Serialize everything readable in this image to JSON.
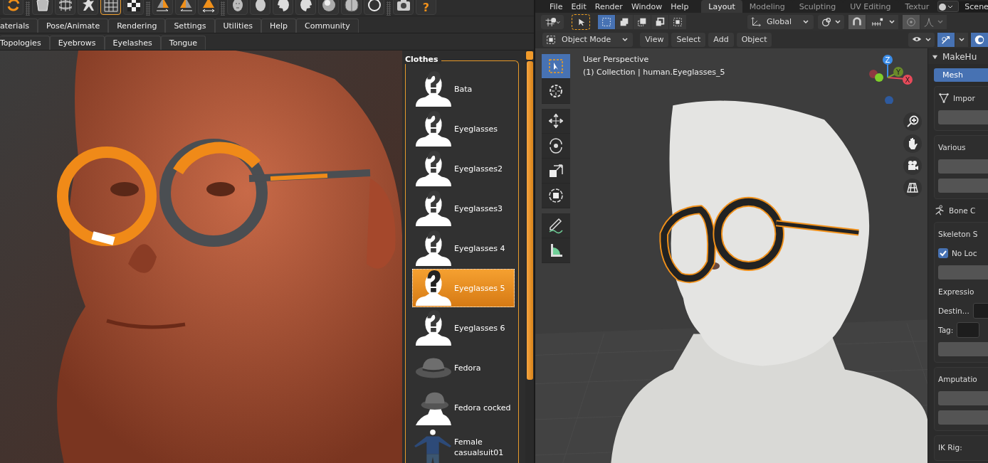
{
  "makehuman": {
    "toolbar": [
      {
        "kind": "rotate",
        "selected": false
      },
      {
        "kind": "separator"
      },
      {
        "kind": "cloth",
        "selected": false
      },
      {
        "kind": "wire",
        "selected": false
      },
      {
        "kind": "figure",
        "selected": false
      },
      {
        "kind": "grid",
        "selected": true
      },
      {
        "kind": "checker",
        "selected": false
      },
      {
        "kind": "separator"
      },
      {
        "kind": "arrow-right",
        "selected": false
      },
      {
        "kind": "arrow-left",
        "selected": false
      },
      {
        "kind": "arrow-both",
        "selected": false
      },
      {
        "kind": "separator"
      },
      {
        "kind": "face",
        "selected": false
      },
      {
        "kind": "egg",
        "selected": false
      },
      {
        "kind": "head-left",
        "selected": false
      },
      {
        "kind": "head-right",
        "selected": false
      },
      {
        "kind": "sphere",
        "selected": false
      },
      {
        "kind": "brain",
        "selected": false
      },
      {
        "kind": "ring",
        "selected": false
      },
      {
        "kind": "separator"
      },
      {
        "kind": "camera",
        "selected": false
      },
      {
        "kind": "help",
        "label": "?",
        "selected": false
      }
    ],
    "tabs": [
      "aterials",
      "Pose/Animate",
      "Rendering",
      "Settings",
      "Utilities",
      "Help",
      "Community"
    ],
    "subtabs": [
      "Topologies",
      "Eyebrows",
      "Eyelashes",
      "Tongue"
    ],
    "clothes": {
      "title": "Clothes",
      "items": [
        {
          "name": "Bata",
          "kind": "silhouette",
          "selected": false
        },
        {
          "name": "Eyeglasses",
          "kind": "silhouette",
          "selected": false
        },
        {
          "name": "Eyeglasses2",
          "kind": "silhouette",
          "selected": false
        },
        {
          "name": "Eyeglasses3",
          "kind": "silhouette",
          "selected": false
        },
        {
          "name": "Eyeglasses 4",
          "kind": "silhouette",
          "selected": false
        },
        {
          "name": "Eyeglasses 5",
          "kind": "silhouette",
          "selected": true
        },
        {
          "name": "Eyeglasses 6",
          "kind": "silhouette",
          "selected": false
        },
        {
          "name": "Fedora",
          "kind": "hat",
          "selected": false
        },
        {
          "name": "Fedora cocked",
          "kind": "hat-figure",
          "selected": false
        },
        {
          "name": "Female casualsuit01",
          "kind": "suit",
          "selected": false
        }
      ]
    }
  },
  "blender": {
    "menu": [
      "File",
      "Edit",
      "Render",
      "Window",
      "Help"
    ],
    "workspaces": [
      {
        "label": "Layout",
        "selected": true
      },
      {
        "label": "Modeling",
        "selected": false
      },
      {
        "label": "Sculpting",
        "selected": false
      },
      {
        "label": "UV Editing",
        "selected": false
      },
      {
        "label": "Textur",
        "selected": false
      }
    ],
    "scene": "Scene",
    "orientation": "Global",
    "mode": "Object Mode",
    "view_menus": [
      "View",
      "Select",
      "Add",
      "Object"
    ],
    "overlay_lines": [
      "User Perspective",
      "(1) Collection | human.Eyeglasses_5"
    ],
    "tools": [
      {
        "kind": "select",
        "selected": true
      },
      {
        "kind": "cursor",
        "selected": false
      },
      {
        "kind": "move",
        "selected": false
      },
      {
        "kind": "rotate",
        "selected": false
      },
      {
        "kind": "scale",
        "selected": false
      },
      {
        "kind": "transform",
        "selected": false
      },
      {
        "kind": "annotate",
        "selected": false
      },
      {
        "kind": "measure",
        "selected": false
      }
    ],
    "axes": [
      "X",
      "Y",
      "Z"
    ],
    "sidebar": {
      "title": "MakeHu",
      "tab": {
        "label": "Mesh",
        "selected": true
      },
      "sections": [
        {
          "kind": "panel",
          "title": "Impor",
          "rows": [
            {
              "kind": "button"
            }
          ]
        },
        {
          "kind": "panel",
          "title": "Various",
          "rows": [
            {
              "kind": "button"
            },
            {
              "kind": "button"
            }
          ]
        },
        {
          "kind": "heading",
          "title": "Bone C"
        },
        {
          "kind": "panel",
          "title": "Skeleton S",
          "rows": [
            {
              "kind": "checkbox",
              "label": "No Loc",
              "checked": true
            },
            {
              "kind": "button"
            },
            {
              "kind": "label",
              "label": "Expressio"
            },
            {
              "kind": "field",
              "label": "Destin..."
            },
            {
              "kind": "field",
              "label": "Tag:"
            },
            {
              "kind": "button"
            }
          ]
        },
        {
          "kind": "panel",
          "title": "Amputatio",
          "rows": [
            {
              "kind": "button"
            },
            {
              "kind": "button"
            }
          ]
        },
        {
          "kind": "panel",
          "title": "IK Rig:"
        }
      ]
    }
  }
}
